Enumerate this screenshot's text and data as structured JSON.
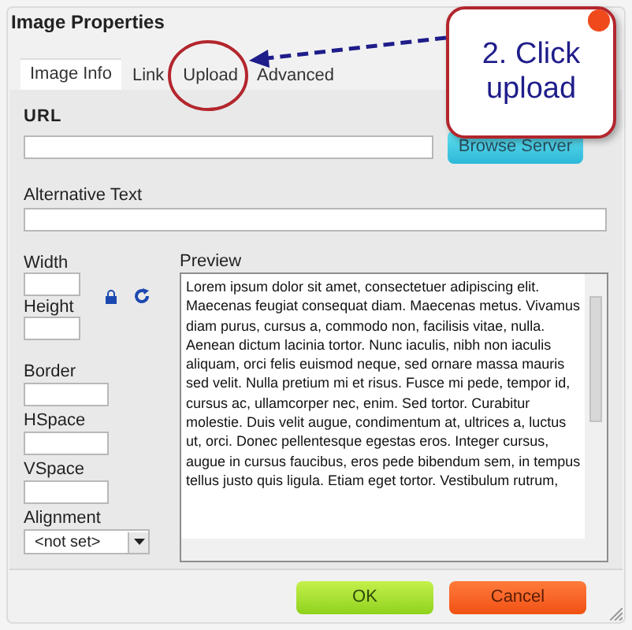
{
  "dialog": {
    "title": "Image Properties"
  },
  "tabs": [
    {
      "label": "Image Info",
      "selected": true
    },
    {
      "label": "Link",
      "selected": false
    },
    {
      "label": "Upload",
      "selected": false
    },
    {
      "label": "Advanced",
      "selected": false
    }
  ],
  "url": {
    "label": "URL"
  },
  "browse_button": "Browse Server",
  "alt_text": {
    "label": "Alternative Text"
  },
  "size_fields": [
    {
      "label": "Width"
    },
    {
      "label": "Height"
    }
  ],
  "spacing_fields": [
    {
      "label": "Border"
    },
    {
      "label": "HSpace"
    },
    {
      "label": "VSpace"
    }
  ],
  "alignment": {
    "label": "Alignment",
    "value": "<not set>"
  },
  "preview": {
    "label": "Preview",
    "text": "Lorem ipsum dolor sit amet, consectetuer adipiscing elit. Maecenas feugiat consequat diam. Maecenas metus. Vivamus diam purus, cursus a, commodo non, facilisis vitae, nulla. Aenean dictum lacinia tortor. Nunc iaculis, nibh non iaculis aliquam, orci felis euismod neque, sed ornare massa mauris sed velit. Nulla pretium mi et risus. Fusce mi pede, tempor id, cursus ac, ullamcorper nec, enim. Sed tortor. Curabitur molestie. Duis velit augue, condimentum at, ultrices a, luctus ut, orci. Donec pellentesque egestas eros. Integer cursus, augue in cursus faucibus, eros pede bibendum sem, in tempus tellus justo quis ligula. Etiam eget tortor. Vestibulum rutrum,"
  },
  "buttons": [
    {
      "label": "OK",
      "kind": "ok"
    },
    {
      "label": "Cancel",
      "kind": "cancel"
    }
  ],
  "callout": {
    "text": "2. Click upload"
  }
}
